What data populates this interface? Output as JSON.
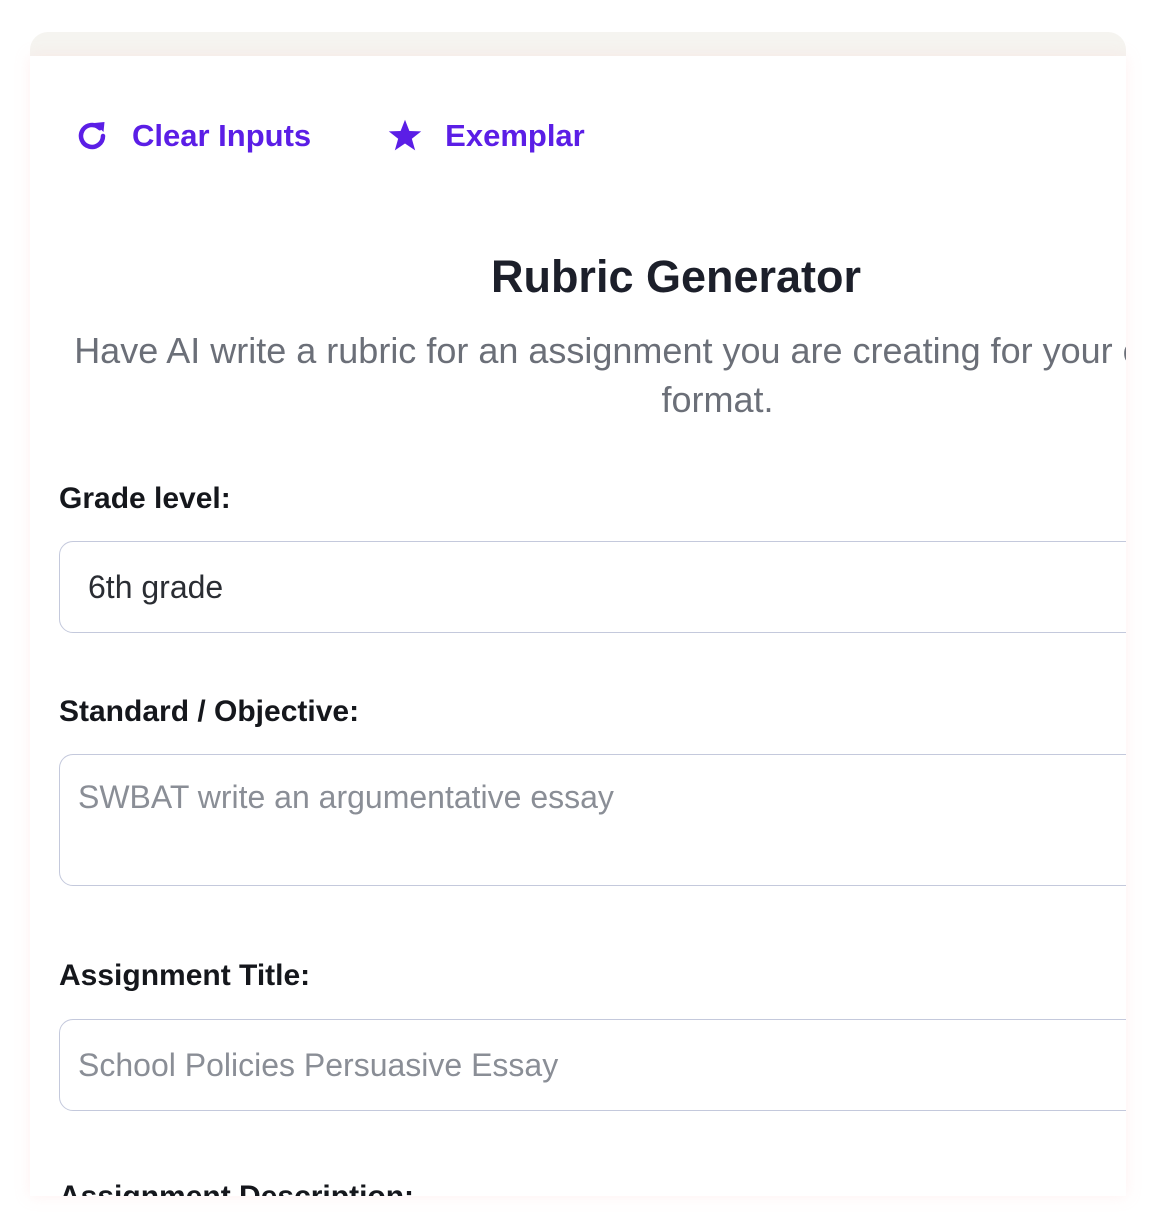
{
  "toolbar": {
    "clear_label": "Clear Inputs",
    "clear_icon": "refresh-icon",
    "exemplar_label": "Exemplar",
    "exemplar_icon": "star-icon",
    "accent_color": "#5b1ee6"
  },
  "header": {
    "title": "Rubric Generator",
    "subtitle": "Have AI write a rubric for an assignment you are creating for your class in a table format."
  },
  "form": {
    "grade": {
      "label": "Grade level:",
      "value": "6th grade"
    },
    "standard": {
      "label": "Standard / Objective:",
      "placeholder": "SWBAT write an argumentative essay"
    },
    "assignment_title": {
      "label": "Assignment Title:",
      "placeholder": "School Policies Persuasive Essay"
    },
    "assignment_description": {
      "label": "Assignment Description:"
    }
  }
}
